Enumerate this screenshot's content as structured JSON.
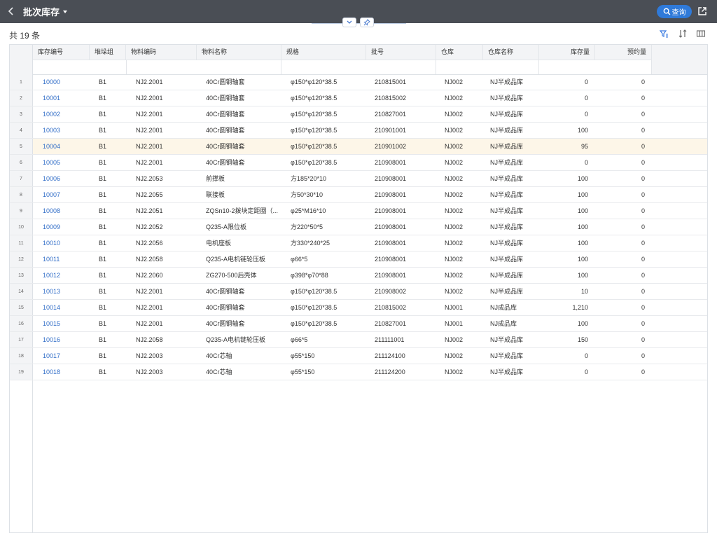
{
  "header": {
    "title": "批次库存",
    "query_label": "查询"
  },
  "summary": {
    "count_text": "共 19 条"
  },
  "table": {
    "columns": [
      "库存编号",
      "堆垛组",
      "物料编码",
      "物料名称",
      "规格",
      "批号",
      "仓库",
      "仓库名称",
      "库存量",
      "预约量"
    ],
    "rows": [
      [
        "1",
        "10000",
        "B1",
        "NJ2.2001",
        "40Cr圆钢轴套",
        "φ150*φ120*38.5",
        "210815001",
        "NJ002",
        "NJ半成品库",
        "0",
        "0"
      ],
      [
        "2",
        "10001",
        "B1",
        "NJ2.2001",
        "40Cr圆钢轴套",
        "φ150*φ120*38.5",
        "210815002",
        "NJ002",
        "NJ半成品库",
        "0",
        "0"
      ],
      [
        "3",
        "10002",
        "B1",
        "NJ2.2001",
        "40Cr圆钢轴套",
        "φ150*φ120*38.5",
        "210827001",
        "NJ002",
        "NJ半成品库",
        "0",
        "0"
      ],
      [
        "4",
        "10003",
        "B1",
        "NJ2.2001",
        "40Cr圆钢轴套",
        "φ150*φ120*38.5",
        "210901001",
        "NJ002",
        "NJ半成品库",
        "100",
        "0"
      ],
      [
        "5",
        "10004",
        "B1",
        "NJ2.2001",
        "40Cr圆钢轴套",
        "φ150*φ120*38.5",
        "210901002",
        "NJ002",
        "NJ半成品库",
        "95",
        "0"
      ],
      [
        "6",
        "10005",
        "B1",
        "NJ2.2001",
        "40Cr圆钢轴套",
        "φ150*φ120*38.5",
        "210908001",
        "NJ002",
        "NJ半成品库",
        "0",
        "0"
      ],
      [
        "7",
        "10006",
        "B1",
        "NJ2.2053",
        "前撑板",
        "方185*20*10",
        "210908001",
        "NJ002",
        "NJ半成品库",
        "100",
        "0"
      ],
      [
        "8",
        "10007",
        "B1",
        "NJ2.2055",
        "联接板",
        "方50*30*10",
        "210908001",
        "NJ002",
        "NJ半成品库",
        "100",
        "0"
      ],
      [
        "9",
        "10008",
        "B1",
        "NJ2.2051",
        "ZQSn10-2拨块定距圈（...",
        "φ25*M16*10",
        "210908001",
        "NJ002",
        "NJ半成品库",
        "100",
        "0"
      ],
      [
        "10",
        "10009",
        "B1",
        "NJ2.2052",
        "Q235-A限位板",
        "方220*50*5",
        "210908001",
        "NJ002",
        "NJ半成品库",
        "100",
        "0"
      ],
      [
        "11",
        "10010",
        "B1",
        "NJ2.2056",
        "电机座板",
        "方330*240*25",
        "210908001",
        "NJ002",
        "NJ半成品库",
        "100",
        "0"
      ],
      [
        "12",
        "10011",
        "B1",
        "NJ2.2058",
        "Q235-A电机链轮压板",
        "φ66*5",
        "210908001",
        "NJ002",
        "NJ半成品库",
        "100",
        "0"
      ],
      [
        "13",
        "10012",
        "B1",
        "NJ2.2060",
        "ZG270-500后壳体",
        "φ398*φ70*88",
        "210908001",
        "NJ002",
        "NJ半成品库",
        "100",
        "0"
      ],
      [
        "14",
        "10013",
        "B1",
        "NJ2.2001",
        "40Cr圆钢轴套",
        "φ150*φ120*38.5",
        "210908002",
        "NJ002",
        "NJ半成品库",
        "10",
        "0"
      ],
      [
        "15",
        "10014",
        "B1",
        "NJ2.2001",
        "40Cr圆钢轴套",
        "φ150*φ120*38.5",
        "210815002",
        "NJ001",
        "NJ成品库",
        "1,210",
        "0"
      ],
      [
        "16",
        "10015",
        "B1",
        "NJ2.2001",
        "40Cr圆钢轴套",
        "φ150*φ120*38.5",
        "210827001",
        "NJ001",
        "NJ成品库",
        "100",
        "0"
      ],
      [
        "17",
        "10016",
        "B1",
        "NJ2.2058",
        "Q235-A电机链轮压板",
        "φ66*5",
        "211111001",
        "NJ002",
        "NJ半成品库",
        "150",
        "0"
      ],
      [
        "18",
        "10017",
        "B1",
        "NJ2.2003",
        "40Cr芯轴",
        "φ55*150",
        "211124100",
        "NJ002",
        "NJ半成品库",
        "0",
        "0"
      ],
      [
        "19",
        "10018",
        "B1",
        "NJ2.2003",
        "40Cr芯轴",
        "φ55*150",
        "211124200",
        "NJ002",
        "NJ半成品库",
        "0",
        "0"
      ]
    ],
    "highlighted_row": 5
  },
  "icons": {
    "back": "chevron-left-icon",
    "title_dropdown": "caret-down-icon",
    "query": "search-icon",
    "export": "external-link-icon",
    "collapse": "chevron-down-icon",
    "pin": "pin-icon",
    "filter": "filter-icon",
    "sort": "sort-icon",
    "columns": "columns-icon"
  },
  "colors": {
    "topbar": "#4a4e55",
    "accent": "#2f7ad9",
    "link": "#2f6cc7",
    "highlight_row": "#fdf6e8"
  }
}
